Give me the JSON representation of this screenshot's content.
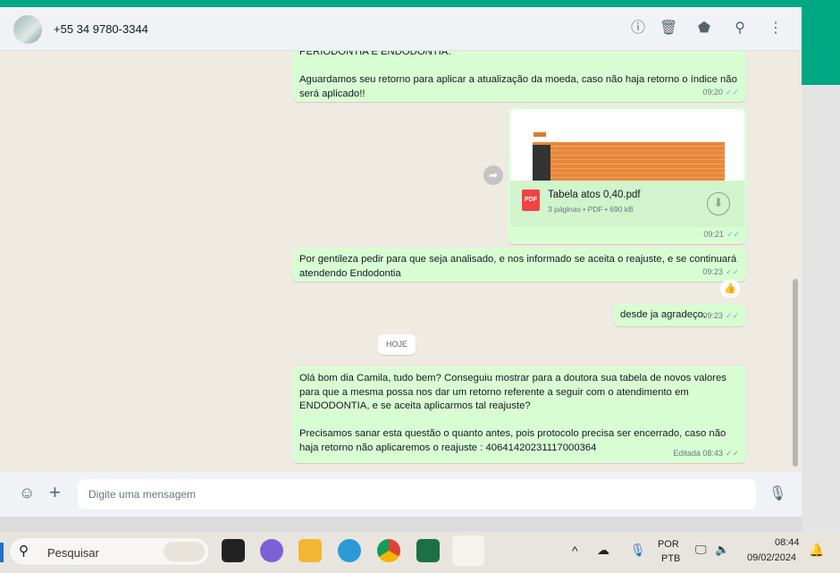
{
  "header": {
    "contact": "+55 34 9780-3344",
    "icons": [
      "info-icon",
      "delete-icon",
      "label-icon",
      "search-icon",
      "menu-icon"
    ]
  },
  "messages": [
    {
      "text": "PERIODONTIA E ENDODONTIA.\n\nAguardamos seu retorno para aplicar a atualização da moeda, caso não haja retorno o índice não será aplicado!!",
      "time": "09:20"
    },
    {
      "file_name": "Tabela atos 0,40.pdf",
      "file_meta": "3 páginas • PDF • 690 kB",
      "file_type": "PDF",
      "time": "09:21"
    },
    {
      "text": "Por gentileza pedir para que seja analisado, e nos informado se aceita o reajuste, e se continuará atendendo Endodontia",
      "time": "09:23",
      "reaction": "👍"
    },
    {
      "text": "desde ja agradeço.",
      "time": "09:23"
    },
    {
      "text": "Olá bom dia Camila, tudo bem? Conseguiu mostrar para a doutora sua tabela de novos valores para que a mesma possa nos dar um retorno referente a seguir com o atendimento em ENDODONTIA, e se aceita aplicarmos tal reajuste?\n\nPrecisamos sanar esta questão o quanto antes, pois protocolo precisa ser encerrado, caso não haja retorno não aplicaremos o reajuste : 40641420231117000364",
      "time": "Editada 08:43"
    }
  ],
  "date_divider": "HOJE",
  "composer": {
    "placeholder": "Digite uma mensagem"
  },
  "taskbar": {
    "search": "Pesquisar",
    "lang1": "POR",
    "lang2": "PTB",
    "time": "08:44",
    "date": "09/02/2024"
  }
}
